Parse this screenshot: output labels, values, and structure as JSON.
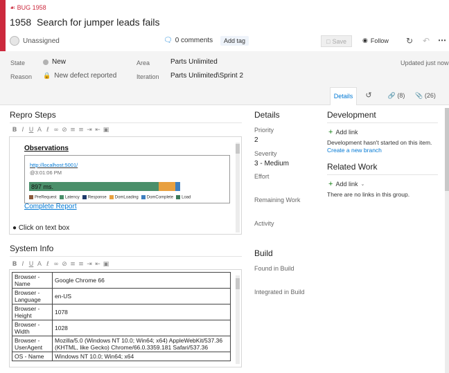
{
  "header": {
    "type_label": "BUG 1958",
    "id": "1958",
    "title": "Search for jumper leads fails",
    "assignee": "Unassigned",
    "comments": "0 comments",
    "add_tag": "Add tag",
    "save": "Save",
    "follow": "Follow",
    "updated": "Updated just now"
  },
  "fields": {
    "state_label": "State",
    "state_value": "New",
    "reason_label": "Reason",
    "reason_value": "New defect reported",
    "area_label": "Area",
    "area_value": "Parts Unlimited",
    "iteration_label": "Iteration",
    "iteration_value": "Parts Unlimited\\Sprint 2"
  },
  "tabs": {
    "details": "Details",
    "links": "(8)",
    "attachments": "(26)"
  },
  "repro": {
    "heading": "Repro Steps",
    "observations": "Observations",
    "url": "http://localhost:5001/",
    "time": "@3:01:06 PM",
    "ms": "897 ms.",
    "legend": [
      "PreRequest",
      "Latency",
      "Response",
      "DomLoading",
      "DomComplete",
      "Load"
    ],
    "legend_colors": [
      "#8c5a3c",
      "#4a8f6a",
      "#1f3a6b",
      "#e8a040",
      "#3f7fbf",
      "#3c7a5a"
    ],
    "timing_fractions": {
      "latency": 0.7,
      "domloading": 0.09,
      "domcomplete": 0.025
    },
    "complete_report": "Complete Report",
    "bullet": "Click on text box"
  },
  "sysinfo": {
    "heading": "System Info",
    "rows": [
      {
        "k": "Browser - Name",
        "v": "Google Chrome 66"
      },
      {
        "k": "Browser - Language",
        "v": "en-US"
      },
      {
        "k": "Browser - Height",
        "v": "1078"
      },
      {
        "k": "Browser - Width",
        "v": "1028"
      },
      {
        "k": "Browser - UserAgent",
        "v": "Mozilla/5.0 (Windows NT 10.0; Win64; x64) AppleWebKit/537.36 (KHTML, like Gecko) Chrome/66.0.3359.181 Safari/537.36"
      },
      {
        "k": "OS - Name",
        "v": "Windows NT 10.0; Win64; x64"
      }
    ]
  },
  "details": {
    "heading": "Details",
    "priority_label": "Priority",
    "priority_value": "2",
    "severity_label": "Severity",
    "severity_value": "3 - Medium",
    "effort_label": "Effort",
    "remaining_label": "Remaining Work",
    "activity_label": "Activity",
    "build_heading": "Build",
    "found_label": "Found in Build",
    "integrated_label": "Integrated in Build"
  },
  "development": {
    "heading": "Development",
    "add_link": "Add link",
    "note": "Development hasn't started on this item.",
    "create_branch": "Create a new branch"
  },
  "related": {
    "heading": "Related Work",
    "add_link": "Add link",
    "note": "There are no links in this group."
  }
}
